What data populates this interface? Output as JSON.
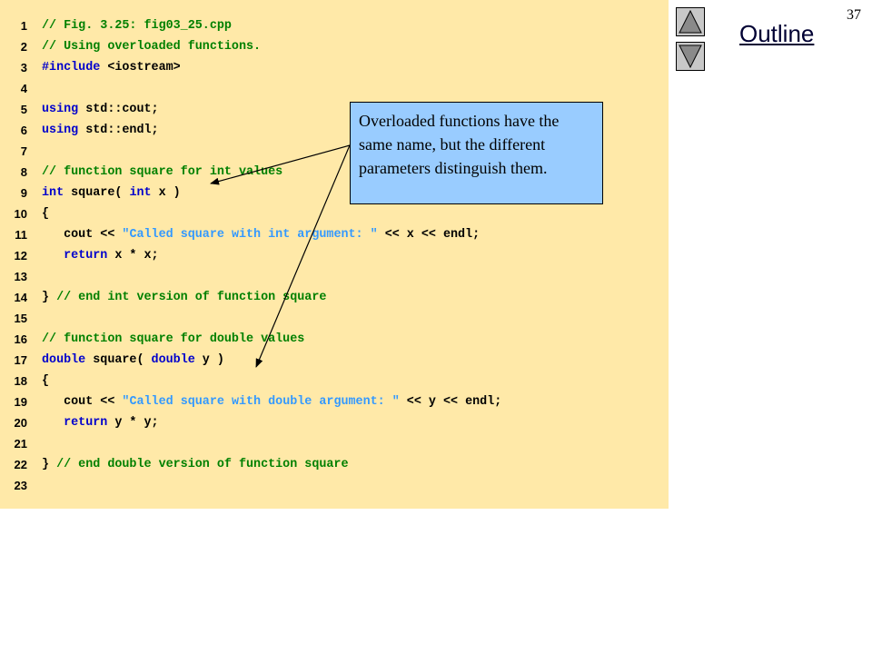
{
  "page": {
    "number": "37",
    "outline_label": "Outline"
  },
  "nav": {
    "up_icon": "triangle-up-icon",
    "down_icon": "triangle-down-icon"
  },
  "callout": {
    "text": "Overloaded functions have the same name, but the different parameters distinguish them."
  },
  "code": {
    "lines": [
      {
        "n": "1",
        "tokens": [
          {
            "t": "comment",
            "s": "// Fig. 3.25: fig03_25.cpp"
          }
        ]
      },
      {
        "n": "2",
        "tokens": [
          {
            "t": "comment",
            "s": "// Using overloaded functions."
          }
        ]
      },
      {
        "n": "3",
        "tokens": [
          {
            "t": "keyword",
            "s": "#include"
          },
          {
            "t": "plain",
            "s": " <iostream>"
          }
        ]
      },
      {
        "n": "4",
        "tokens": []
      },
      {
        "n": "5",
        "tokens": [
          {
            "t": "keyword",
            "s": "using"
          },
          {
            "t": "plain",
            "s": " std::cout;"
          }
        ]
      },
      {
        "n": "6",
        "tokens": [
          {
            "t": "keyword",
            "s": "using"
          },
          {
            "t": "plain",
            "s": " std::endl;"
          }
        ]
      },
      {
        "n": "7",
        "tokens": []
      },
      {
        "n": "8",
        "tokens": [
          {
            "t": "comment",
            "s": "// function square for int values"
          }
        ]
      },
      {
        "n": "9",
        "tokens": [
          {
            "t": "keyword",
            "s": "int"
          },
          {
            "t": "plain",
            "s": " square( "
          },
          {
            "t": "keyword",
            "s": "int"
          },
          {
            "t": "plain",
            "s": " x )"
          }
        ]
      },
      {
        "n": "10",
        "tokens": [
          {
            "t": "plain",
            "s": "{"
          }
        ]
      },
      {
        "n": "11",
        "tokens": [
          {
            "t": "plain",
            "s": "   cout << "
          },
          {
            "t": "string",
            "s": "\"Called square with int argument: \""
          },
          {
            "t": "plain",
            "s": " << x << endl;"
          }
        ]
      },
      {
        "n": "12",
        "tokens": [
          {
            "t": "plain",
            "s": "   "
          },
          {
            "t": "keyword",
            "s": "return"
          },
          {
            "t": "plain",
            "s": " x * x;"
          }
        ]
      },
      {
        "n": "13",
        "tokens": []
      },
      {
        "n": "14",
        "tokens": [
          {
            "t": "plain",
            "s": "} "
          },
          {
            "t": "comment",
            "s": "// end int version of function square"
          }
        ]
      },
      {
        "n": "15",
        "tokens": []
      },
      {
        "n": "16",
        "tokens": [
          {
            "t": "comment",
            "s": "// function square for double values"
          }
        ]
      },
      {
        "n": "17",
        "tokens": [
          {
            "t": "keyword",
            "s": "double"
          },
          {
            "t": "plain",
            "s": " square( "
          },
          {
            "t": "keyword",
            "s": "double"
          },
          {
            "t": "plain",
            "s": " y )"
          }
        ]
      },
      {
        "n": "18",
        "tokens": [
          {
            "t": "plain",
            "s": "{"
          }
        ]
      },
      {
        "n": "19",
        "tokens": [
          {
            "t": "plain",
            "s": "   cout << "
          },
          {
            "t": "string",
            "s": "\"Called square with double argument: \""
          },
          {
            "t": "plain",
            "s": " << y << endl;"
          }
        ]
      },
      {
        "n": "20",
        "tokens": [
          {
            "t": "plain",
            "s": "   "
          },
          {
            "t": "keyword",
            "s": "return"
          },
          {
            "t": "plain",
            "s": " y * y;"
          }
        ]
      },
      {
        "n": "21",
        "tokens": []
      },
      {
        "n": "22",
        "tokens": [
          {
            "t": "plain",
            "s": "} "
          },
          {
            "t": "comment",
            "s": "// end double version of function square"
          }
        ]
      },
      {
        "n": "23",
        "tokens": []
      }
    ]
  },
  "colors": {
    "panel": "#ffe9a8",
    "callout": "#99ccff",
    "comment": "#008000",
    "keyword": "#0000cc",
    "string": "#3399ff"
  }
}
